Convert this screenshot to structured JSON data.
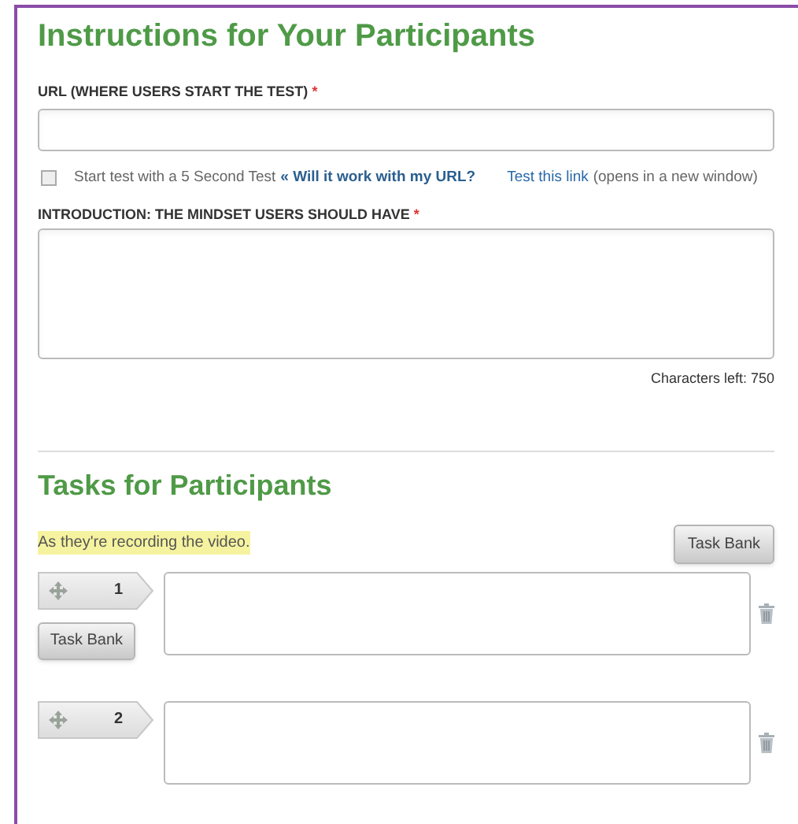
{
  "instructions": {
    "heading": "Instructions for Your Participants",
    "url_field": {
      "label": "URL (WHERE USERS START THE TEST)",
      "required_mark": "*"
    },
    "five_second": {
      "checked": false,
      "label": "Start test with a 5 Second Test",
      "help_link": "« Will it work with my URL?",
      "test_link": "Test this link",
      "test_note": "(opens in a new window)"
    },
    "intro_field": {
      "label": "INTRODUCTION: THE MINDSET USERS SHOULD HAVE",
      "required_mark": "*",
      "counter": "Characters left: 750"
    }
  },
  "tasks": {
    "heading": "Tasks for Participants",
    "hint": "As they're recording the video.",
    "task_bank_button": "Task Bank",
    "items": [
      {
        "number": "1",
        "task_bank_button": "Task Bank"
      },
      {
        "number": "2"
      }
    ]
  }
}
